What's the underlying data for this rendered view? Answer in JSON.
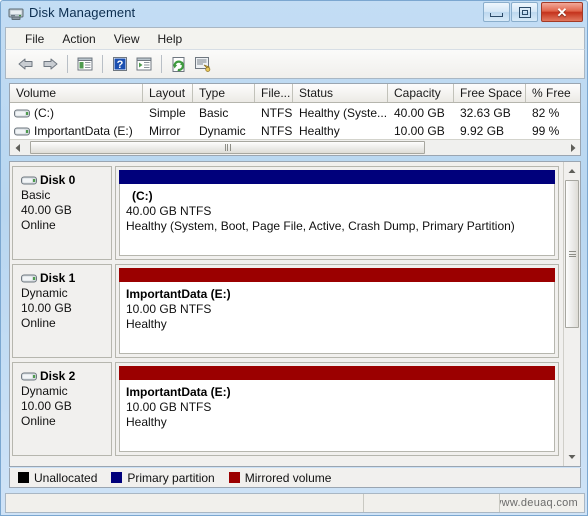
{
  "window": {
    "title": "Disk Management",
    "app_icon": "disk-management-icon",
    "buttons": {
      "minimize": "minimize-button",
      "maximize": "maximize-button",
      "close": "close-button",
      "close_glyph": "✕"
    }
  },
  "menubar": {
    "items": [
      {
        "label": "File"
      },
      {
        "label": "Action"
      },
      {
        "label": "View"
      },
      {
        "label": "Help"
      }
    ]
  },
  "toolbar": {
    "buttons": [
      {
        "icon": "back-arrow-icon"
      },
      {
        "icon": "forward-arrow-icon"
      },
      {
        "icon": "show-hide-console-tree-icon"
      },
      {
        "icon": "help-icon"
      },
      {
        "icon": "show-hide-action-pane-icon"
      },
      {
        "icon": "refresh-icon"
      },
      {
        "icon": "properties-icon"
      }
    ]
  },
  "volume_list": {
    "columns": [
      {
        "label": "Volume"
      },
      {
        "label": "Layout"
      },
      {
        "label": "Type"
      },
      {
        "label": "File..."
      },
      {
        "label": "Status"
      },
      {
        "label": "Capacity"
      },
      {
        "label": "Free Space"
      },
      {
        "label": "% Free"
      }
    ],
    "rows": [
      {
        "volume": "(C:)",
        "layout": "Simple",
        "type": "Basic",
        "filesystem": "NTFS",
        "status": "Healthy (Syste...",
        "capacity": "40.00 GB",
        "free_space": "32.63 GB",
        "percent_free": "82 %"
      },
      {
        "volume": "ImportantData (E:)",
        "layout": "Mirror",
        "type": "Dynamic",
        "filesystem": "NTFS",
        "status": "Healthy",
        "capacity": "10.00 GB",
        "free_space": "9.92 GB",
        "percent_free": "99 %"
      }
    ]
  },
  "graphical_view": {
    "disks": [
      {
        "name": "Disk 0",
        "type": "Basic",
        "size": "40.00 GB",
        "state": "Online",
        "volume": {
          "label": "(C:)",
          "size_fs": "40.00 GB NTFS",
          "status": "Healthy (System, Boot, Page File, Active, Crash Dump, Primary Partition)",
          "bar_color": "#00007b"
        }
      },
      {
        "name": "Disk 1",
        "type": "Dynamic",
        "size": "10.00 GB",
        "state": "Online",
        "volume": {
          "label": "ImportantData  (E:)",
          "size_fs": "10.00 GB NTFS",
          "status": "Healthy",
          "bar_color": "#9b0000"
        }
      },
      {
        "name": "Disk 2",
        "type": "Dynamic",
        "size": "10.00 GB",
        "state": "Online",
        "volume": {
          "label": "ImportantData  (E:)",
          "size_fs": "10.00 GB NTFS",
          "status": "Healthy",
          "bar_color": "#9b0000"
        }
      }
    ]
  },
  "legend": {
    "items": [
      {
        "label": "Unallocated",
        "color": "#000000"
      },
      {
        "label": "Primary partition",
        "color": "#00007b"
      },
      {
        "label": "Mirrored volume",
        "color": "#9b0000"
      }
    ]
  },
  "statusbar": {
    "pane_left": "",
    "pane_middle": "",
    "watermark": "www.deuaq.com"
  },
  "colors": {
    "primary_partition": "#00007b",
    "mirrored_volume": "#9b0000",
    "unallocated": "#000000",
    "window_frame": "#b8d6f0"
  }
}
